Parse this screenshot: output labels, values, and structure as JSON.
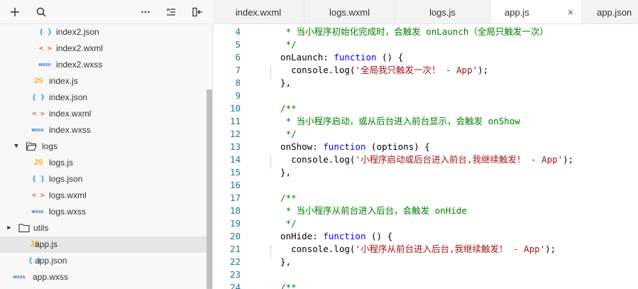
{
  "sidebar": {
    "toolbar": {
      "add_icon": "plus-icon",
      "search_icon": "search-icon",
      "more_icon": "more-icon",
      "sort_icon": "collapse-icon",
      "layout_icon": "panel-toggle-icon"
    },
    "tree": [
      {
        "type": "json",
        "icon": "{ }",
        "label": "index2.json",
        "depth": 3
      },
      {
        "type": "wxml",
        "icon": "< >",
        "label": "index2.wxml",
        "depth": 3
      },
      {
        "type": "wxss",
        "icon": "wxss",
        "label": "index2.wxss",
        "depth": 3
      },
      {
        "type": "js",
        "icon": "JS",
        "label": "index.js",
        "depth": 2
      },
      {
        "type": "json",
        "icon": "{ }",
        "label": "index.json",
        "depth": 2
      },
      {
        "type": "wxml",
        "icon": "< >",
        "label": "index.wxml",
        "depth": 2
      },
      {
        "type": "wxss",
        "icon": "wxss",
        "label": "index.wxss",
        "depth": 2
      },
      {
        "type": "folder-open",
        "icon": "▼",
        "label": "logs",
        "depth": 1
      },
      {
        "type": "js",
        "icon": "JS",
        "label": "logs.js",
        "depth": 2
      },
      {
        "type": "json",
        "icon": "{ }",
        "label": "logs.json",
        "depth": 2
      },
      {
        "type": "wxml",
        "icon": "< >",
        "label": "logs.wxml",
        "depth": 2
      },
      {
        "type": "wxss",
        "icon": "wxss",
        "label": "logs.wxss",
        "depth": 2
      },
      {
        "type": "folder-closed",
        "icon": "▶",
        "label": "utils",
        "depth": 0
      },
      {
        "type": "js",
        "icon": "JS",
        "label": "app.js",
        "depth": 1,
        "selected": true
      },
      {
        "type": "json",
        "icon": "{ }",
        "label": "app.json",
        "depth": 1
      },
      {
        "type": "wxss",
        "icon": "wxss",
        "label": "app.wxss",
        "depth": 0
      }
    ]
  },
  "tabs": [
    {
      "label": "index.wxml",
      "active": false
    },
    {
      "label": "logs.wxml",
      "active": false
    },
    {
      "label": "logs.js",
      "active": false
    },
    {
      "label": "app.js",
      "active": true,
      "close": "×"
    },
    {
      "label": "app.json",
      "active": false
    }
  ],
  "editor": {
    "lines": [
      {
        "n": "4",
        "tokens": [
          {
            "t": "c",
            "v": "   * 当小程序初始化完成时，会触发 onLaunch（全局只触发一次）"
          }
        ]
      },
      {
        "n": "5",
        "tokens": [
          {
            "t": "c",
            "v": "   */"
          }
        ]
      },
      {
        "n": "6",
        "tokens": [
          {
            "t": "p",
            "v": "  onLaunch: "
          },
          {
            "t": "k",
            "v": "function"
          },
          {
            "t": "p",
            "v": " () {"
          }
        ]
      },
      {
        "n": "7",
        "tokens": [
          {
            "t": "p",
            "v": "    console.log("
          },
          {
            "t": "s",
            "v": "'全局我只触发一次！ - App'"
          },
          {
            "t": "p",
            "v": ");"
          }
        ]
      },
      {
        "n": "8",
        "tokens": [
          {
            "t": "p",
            "v": "  },"
          }
        ]
      },
      {
        "n": "9",
        "tokens": []
      },
      {
        "n": "10",
        "tokens": [
          {
            "t": "c",
            "v": "  /**"
          }
        ]
      },
      {
        "n": "11",
        "tokens": [
          {
            "t": "c",
            "v": "   * 当小程序启动，或从后台进入前台显示，会触发 onShow"
          }
        ]
      },
      {
        "n": "12",
        "tokens": [
          {
            "t": "c",
            "v": "   */"
          }
        ]
      },
      {
        "n": "13",
        "tokens": [
          {
            "t": "p",
            "v": "  onShow: "
          },
          {
            "t": "k",
            "v": "function"
          },
          {
            "t": "p",
            "v": " (options) {"
          }
        ]
      },
      {
        "n": "14",
        "tokens": [
          {
            "t": "p",
            "v": "    console.log("
          },
          {
            "t": "s",
            "v": "'小程序启动或后台进入前台,我继续触发！ - App'"
          },
          {
            "t": "p",
            "v": ");"
          }
        ]
      },
      {
        "n": "15",
        "tokens": [
          {
            "t": "p",
            "v": "  },"
          }
        ]
      },
      {
        "n": "16",
        "tokens": []
      },
      {
        "n": "17",
        "tokens": [
          {
            "t": "c",
            "v": "  /**"
          }
        ]
      },
      {
        "n": "18",
        "tokens": [
          {
            "t": "c",
            "v": "   * 当小程序从前台进入后台，会触发 onHide"
          }
        ]
      },
      {
        "n": "19",
        "tokens": [
          {
            "t": "c",
            "v": "   */"
          }
        ]
      },
      {
        "n": "20",
        "tokens": [
          {
            "t": "p",
            "v": "  onHide: "
          },
          {
            "t": "k",
            "v": "function"
          },
          {
            "t": "p",
            "v": " () {"
          }
        ]
      },
      {
        "n": "21",
        "tokens": [
          {
            "t": "p",
            "v": "    console.log("
          },
          {
            "t": "s",
            "v": "'小程序从前台进入后台,我继续触发！ - App'"
          },
          {
            "t": "p",
            "v": ");"
          }
        ]
      },
      {
        "n": "22",
        "tokens": [
          {
            "t": "p",
            "v": "  },"
          }
        ]
      },
      {
        "n": "23",
        "tokens": []
      },
      {
        "n": "24",
        "tokens": [
          {
            "t": "c",
            "v": "  /**"
          }
        ]
      }
    ]
  },
  "colors": {
    "comment": "#008000",
    "keyword": "#0000ff",
    "string": "#a31515",
    "line_number": "#237893"
  }
}
